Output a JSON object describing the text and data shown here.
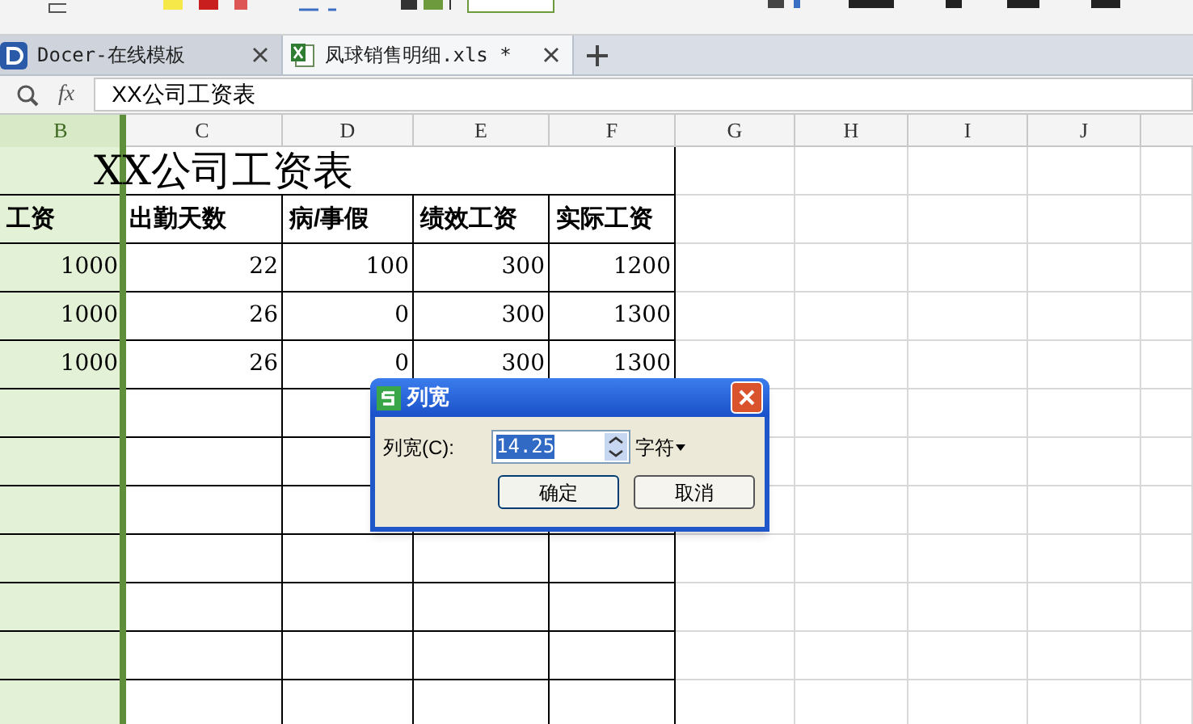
{
  "tabs": [
    {
      "label": "Docer-在线模板",
      "kind": "docer",
      "selected": false
    },
    {
      "label": "凤球销售明细.xls *",
      "kind": "sheet",
      "selected": true
    }
  ],
  "formula_bar": {
    "fx_label": "fx",
    "value": "XX公司工资表"
  },
  "columns": [
    {
      "label": "B",
      "selected": true
    },
    {
      "label": "C",
      "selected": false
    },
    {
      "label": "D",
      "selected": false
    },
    {
      "label": "E",
      "selected": false
    },
    {
      "label": "F",
      "selected": false
    },
    {
      "label": "G",
      "selected": false
    },
    {
      "label": "H",
      "selected": false
    },
    {
      "label": "I",
      "selected": false
    },
    {
      "label": "J",
      "selected": false
    }
  ],
  "sheet": {
    "title": "XX公司工资表",
    "headers": [
      "工资",
      "出勤天数",
      "病/事假",
      "绩效工资",
      "实际工资"
    ],
    "rows": [
      [
        "1000",
        "22",
        "100",
        "300",
        "1200"
      ],
      [
        "1000",
        "26",
        "0",
        "300",
        "1300"
      ],
      [
        "1000",
        "26",
        "0",
        "300",
        "1300"
      ]
    ]
  },
  "dialog": {
    "title": "列宽",
    "field_label": "列宽(C):",
    "value": "14.25",
    "unit": "字符",
    "buttons": [
      "确定",
      "取消"
    ]
  }
}
